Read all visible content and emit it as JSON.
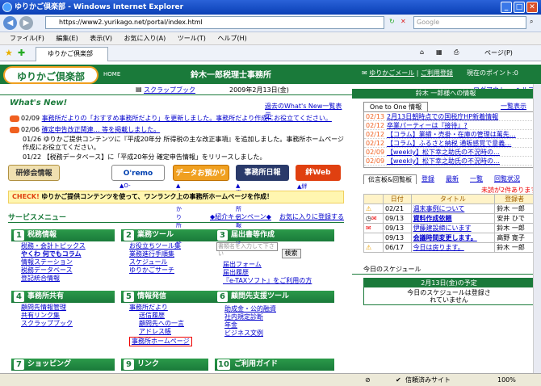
{
  "window": {
    "title": "ゆりかご倶楽部 - Windows Internet Explorer",
    "minimize": "_",
    "maximize": "□",
    "close": "✕"
  },
  "browser": {
    "url": "https://www2.yurikago.net/portal/index.html",
    "search_placeholder": "Google",
    "tab_title": "ゆりかご倶楽部",
    "page_menu": "ページ(P)"
  },
  "menu": [
    "ファイル(F)",
    "編集(E)",
    "表示(V)",
    "お気に入り(A)",
    "ツール(T)",
    "ヘルプ(H)"
  ],
  "site": {
    "logo": "ゆりかご倶楽部",
    "home": "HOME",
    "office": "鈴木一郎税理士事務所",
    "mail": "ゆりかごメール",
    "usage": "ご利用登録",
    "points": "現在のポイント:0",
    "scrapbook": "スクラップブック",
    "date": "2009年2月13日(金)",
    "logout": "ログアウト",
    "help": "ヘルプ"
  },
  "whatsnew": {
    "title": "What's New!",
    "list_link": "過去のWhat's New一覧表示",
    "items": [
      {
        "date": "02/09",
        "text": "事務所だよりの「おすすめ事務所だより」を更新しました。事務所だより作成にお役立てください。"
      },
      {
        "date": "02/06",
        "text": "確定申告改正関連… 等を掲載しました。"
      },
      {
        "date": "01/26",
        "text": "ゆりかご提供コンテンツに『平成20年分 所得税の主な改正事項』を追加しました。事務所ホームページ作成にお役立てください。"
      },
      {
        "date": "01/22",
        "text": "【税務データベース】に「平成20年分 確定申告情報」をリリースしました。"
      }
    ]
  },
  "banners": [
    {
      "label": "研修会情報",
      "caption": ""
    },
    {
      "label": "O'remo",
      "caption": "▲O-remoとは"
    },
    {
      "label": "データお預かり所",
      "caption": "▲お預かり所とは"
    },
    {
      "label": "事務所日報",
      "caption": "▲事務所日報とは"
    },
    {
      "label": "絆Web",
      "caption": "▲絆WEBとは"
    }
  ],
  "check": {
    "tag": "CHECK!",
    "text": "ゆりかご提供コンテンツを使って、ワンランク上の事務所ホームページを作成！"
  },
  "service": {
    "title": "サービスメニュー",
    "campaign": "◆紹介キャンペーン◆",
    "favorite": "お気に入りに登録する",
    "categories": [
      {
        "num": "1",
        "title": "税務情報",
        "items": [
          "税務・会計トピックス",
          "やくわ 何でもコラム",
          "情報ステーション",
          "税務データベース",
          "登記統合情報"
        ]
      },
      {
        "num": "2",
        "title": "業務ツール",
        "items": [
          "お役立ちツール集",
          "業務進行手順集",
          "スケジュール",
          "ゆりかごサーチ"
        ]
      },
      {
        "num": "3",
        "title": "届出書等作成",
        "items": [
          "書類名を入力して下さい",
          "届出フォーム",
          "届出履歴",
          "『e-TAXソフト』をご利用の方"
        ]
      },
      {
        "num": "4",
        "title": "事務所共有",
        "items": [
          "顧問先情報管理",
          "共有リンク集",
          "スクラップブック"
        ]
      },
      {
        "num": "5",
        "title": "情報発信",
        "items": [
          "事務所だより",
          "送信履歴",
          "顧問先への一言",
          "アドレス帳",
          "事務所ホームページ"
        ]
      },
      {
        "num": "6",
        "title": "顧問先支援ツール",
        "items": [
          "助成金・公的融資",
          "社内規定診断",
          "年金",
          "ビジネス文例"
        ]
      },
      {
        "num": "7",
        "title": "ショッピング",
        "items": []
      },
      {
        "num": "9",
        "title": "リンク",
        "items": []
      },
      {
        "num": "10",
        "title": "ご利用ガイド",
        "items": []
      }
    ],
    "search_btn": "検索"
  },
  "right": {
    "header": "鈴木 一郎様への情報",
    "oto_tab": "One to One 情報",
    "oto_list": "一覧表示",
    "oto_items": [
      {
        "date": "02/13",
        "text": "2月13日朝時点での国税庁HP新着情報"
      },
      {
        "date": "02/12",
        "text": "卒業パーティーは『接待』?"
      },
      {
        "date": "02/12",
        "text": "【コラム】業績・売掛・在庫の管理は萬先…"
      },
      {
        "date": "02/12",
        "text": "【コラム】ふるさと納税 通販感覚で意義…"
      },
      {
        "date": "02/09",
        "text": "【weekly】松下幸之助氏の不況時の…"
      },
      {
        "date": "02/09",
        "text": "【weekly】松下幸之助氏の不況時の…"
      }
    ],
    "bb_tab": "伝言板&回覧板",
    "bb_actions": [
      "登録",
      "最新",
      "一覧",
      "回覧状況"
    ],
    "bb_unread": "未読が2件あります",
    "bb_cols": [
      "日付",
      "タイトル",
      "登録者"
    ],
    "bb_rows": [
      {
        "date": "02/21",
        "title": "週末事例について",
        "author": "鈴木 一郎"
      },
      {
        "date": "09/13",
        "title": "資料作成依頼",
        "author": "安井 ひで"
      },
      {
        "date": "09/13",
        "title": "伊藤建設締にいます",
        "author": "鈴木 一郎"
      },
      {
        "date": "09/13",
        "title": "会議時間変更します。",
        "author": "高野 寛子"
      },
      {
        "date": "06/17",
        "title": "今日は房ります。",
        "author": "鈴木 一郎"
      }
    ],
    "sched_title": "今日のスケジュール",
    "sched_date": "2月13日(金)の予定",
    "sched_text": "今日のスケジュールは登録されていません"
  },
  "status": {
    "security": "信頼済みサイト",
    "zoom": "100%"
  }
}
